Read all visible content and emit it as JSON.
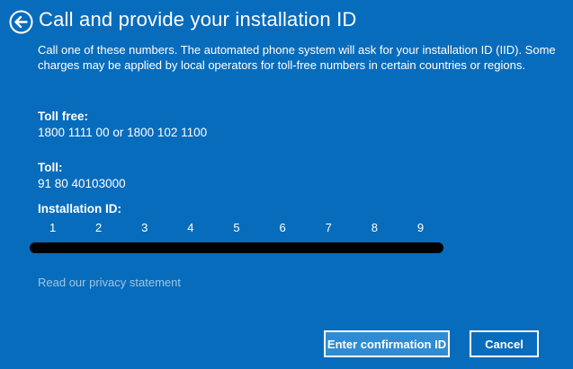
{
  "colors": {
    "background": "#086cbc",
    "button_primary_fill": "#2f8cd3",
    "link_color": "#9ec6e6",
    "redaction": "#000000"
  },
  "header": {
    "back_icon": "back-arrow-in-circle",
    "title": "Call and provide your installation ID"
  },
  "description": {
    "line1": "Call one of these numbers. The automated phone system will ask for your installation ID (IID). Some",
    "line2": "charges may be applied by local operators for toll-free numbers in certain countries or regions."
  },
  "toll_free": {
    "label": "Toll free:",
    "numbers": "1800 1111 00 or 1800 102 1100"
  },
  "toll": {
    "label": "Toll:",
    "number": "91 80 40103000"
  },
  "installation_id": {
    "label": "Installation ID:",
    "groups": [
      "1",
      "2",
      "3",
      "4",
      "5",
      "6",
      "7",
      "8",
      "9"
    ],
    "value_state": "redacted"
  },
  "footer": {
    "privacy_link": "Read our privacy statement",
    "enter_confirmation_button": "Enter confirmation ID",
    "cancel_button": "Cancel"
  }
}
